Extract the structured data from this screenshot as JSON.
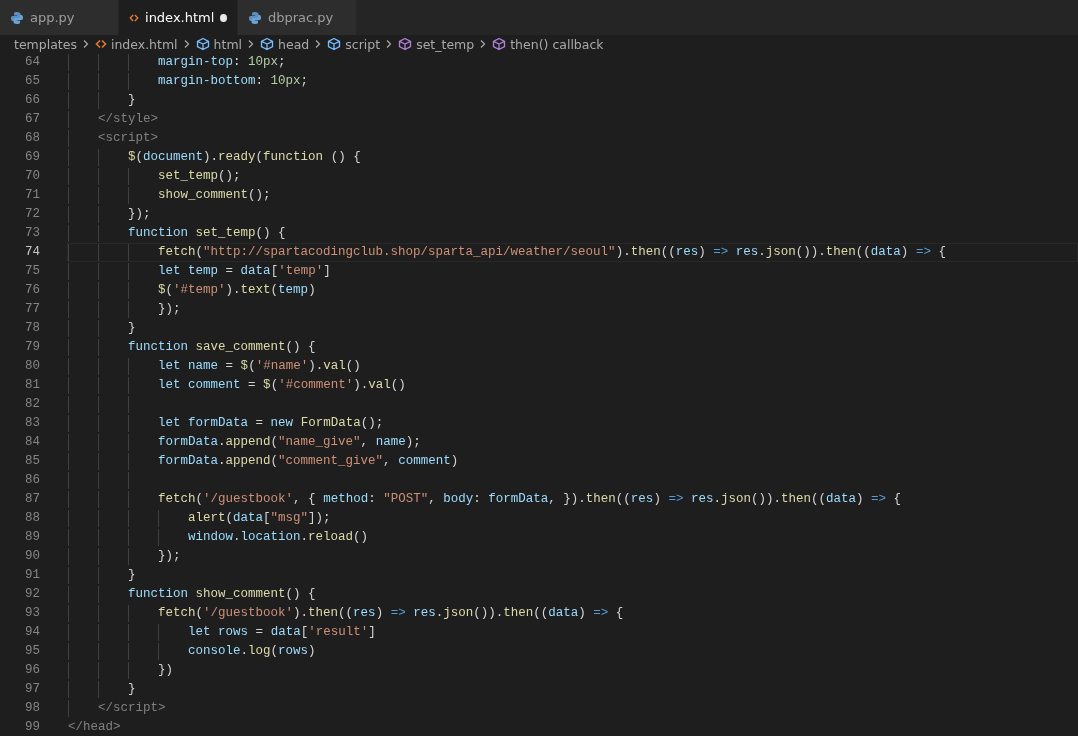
{
  "tabs": [
    {
      "label": "app.py",
      "kind": "python",
      "selected": false,
      "modified": false
    },
    {
      "label": "index.html",
      "kind": "html",
      "selected": true,
      "modified": true
    },
    {
      "label": "dbprac.py",
      "kind": "python",
      "selected": false,
      "modified": false
    }
  ],
  "breadcrumbs": [
    {
      "label": "templates",
      "kind": "folder"
    },
    {
      "label": "index.html",
      "kind": "html"
    },
    {
      "label": "html",
      "kind": "element"
    },
    {
      "label": "head",
      "kind": "element"
    },
    {
      "label": "script",
      "kind": "element"
    },
    {
      "label": "set_temp",
      "kind": "function"
    },
    {
      "label": "then() callback",
      "kind": "function"
    }
  ],
  "lines": [
    {
      "number": "64",
      "text": "            margin-top: 10px;",
      "current": false
    },
    {
      "number": "65",
      "text": "            margin-bottom: 10px;",
      "current": false
    },
    {
      "number": "66",
      "text": "        }",
      "current": false
    },
    {
      "number": "67",
      "text": "    </style>",
      "current": false
    },
    {
      "number": "68",
      "text": "    <script>",
      "current": false
    },
    {
      "number": "69",
      "text": "        $(document).ready(function () {",
      "current": false
    },
    {
      "number": "70",
      "text": "            set_temp();",
      "current": false
    },
    {
      "number": "71",
      "text": "            show_comment();",
      "current": false
    },
    {
      "number": "72",
      "text": "        });",
      "current": false
    },
    {
      "number": "73",
      "text": "        function set_temp() {",
      "current": false
    },
    {
      "number": "74",
      "text": "            fetch(\"http://spartacodingclub.shop/sparta_api/weather/seoul\").then((res) => res.json()).then((data) => {",
      "current": true
    },
    {
      "number": "75",
      "text": "            let temp = data['temp']",
      "current": false
    },
    {
      "number": "76",
      "text": "            $('#temp').text(temp)",
      "current": false
    },
    {
      "number": "77",
      "text": "            });",
      "current": false
    },
    {
      "number": "78",
      "text": "        }",
      "current": false
    },
    {
      "number": "79",
      "text": "        function save_comment() {",
      "current": false
    },
    {
      "number": "80",
      "text": "            let name = $('#name').val()",
      "current": false
    },
    {
      "number": "81",
      "text": "            let comment = $('#comment').val()",
      "current": false
    },
    {
      "number": "82",
      "current": false
    },
    {
      "number": "83",
      "text": "            let formData = new FormData();",
      "current": false
    },
    {
      "number": "84",
      "text": "            formData.append(\"name_give\", name);",
      "current": false
    },
    {
      "number": "85",
      "text": "            formData.append(\"comment_give\", comment)",
      "current": false
    },
    {
      "number": "86",
      "current": false
    },
    {
      "number": "87",
      "text": "            fetch('/guestbook', { method: \"POST\", body: formData, }).then((res) => res.json()).then((data) => {",
      "current": false
    },
    {
      "number": "88",
      "text": "                alert(data[\"msg\"]);",
      "current": false
    },
    {
      "number": "89",
      "text": "                window.location.reload()",
      "current": false
    },
    {
      "number": "90",
      "text": "            });",
      "current": false
    },
    {
      "number": "91",
      "text": "        }",
      "current": false
    },
    {
      "number": "92",
      "text": "        function show_comment() {",
      "current": false
    },
    {
      "number": "93",
      "text": "            fetch('/guestbook').then((res) => res.json()).then((data) => {",
      "current": false
    },
    {
      "number": "94",
      "text": "                let rows = data['result']",
      "current": false
    },
    {
      "number": "95",
      "text": "                console.log(rows)",
      "current": false
    },
    {
      "number": "96",
      "text": "            })",
      "current": false
    },
    {
      "number": "97",
      "text": "        }",
      "current": false
    },
    {
      "number": "98",
      "text": "    </script>",
      "current": false
    },
    {
      "number": "99",
      "text": "</head>",
      "current": false
    }
  ]
}
